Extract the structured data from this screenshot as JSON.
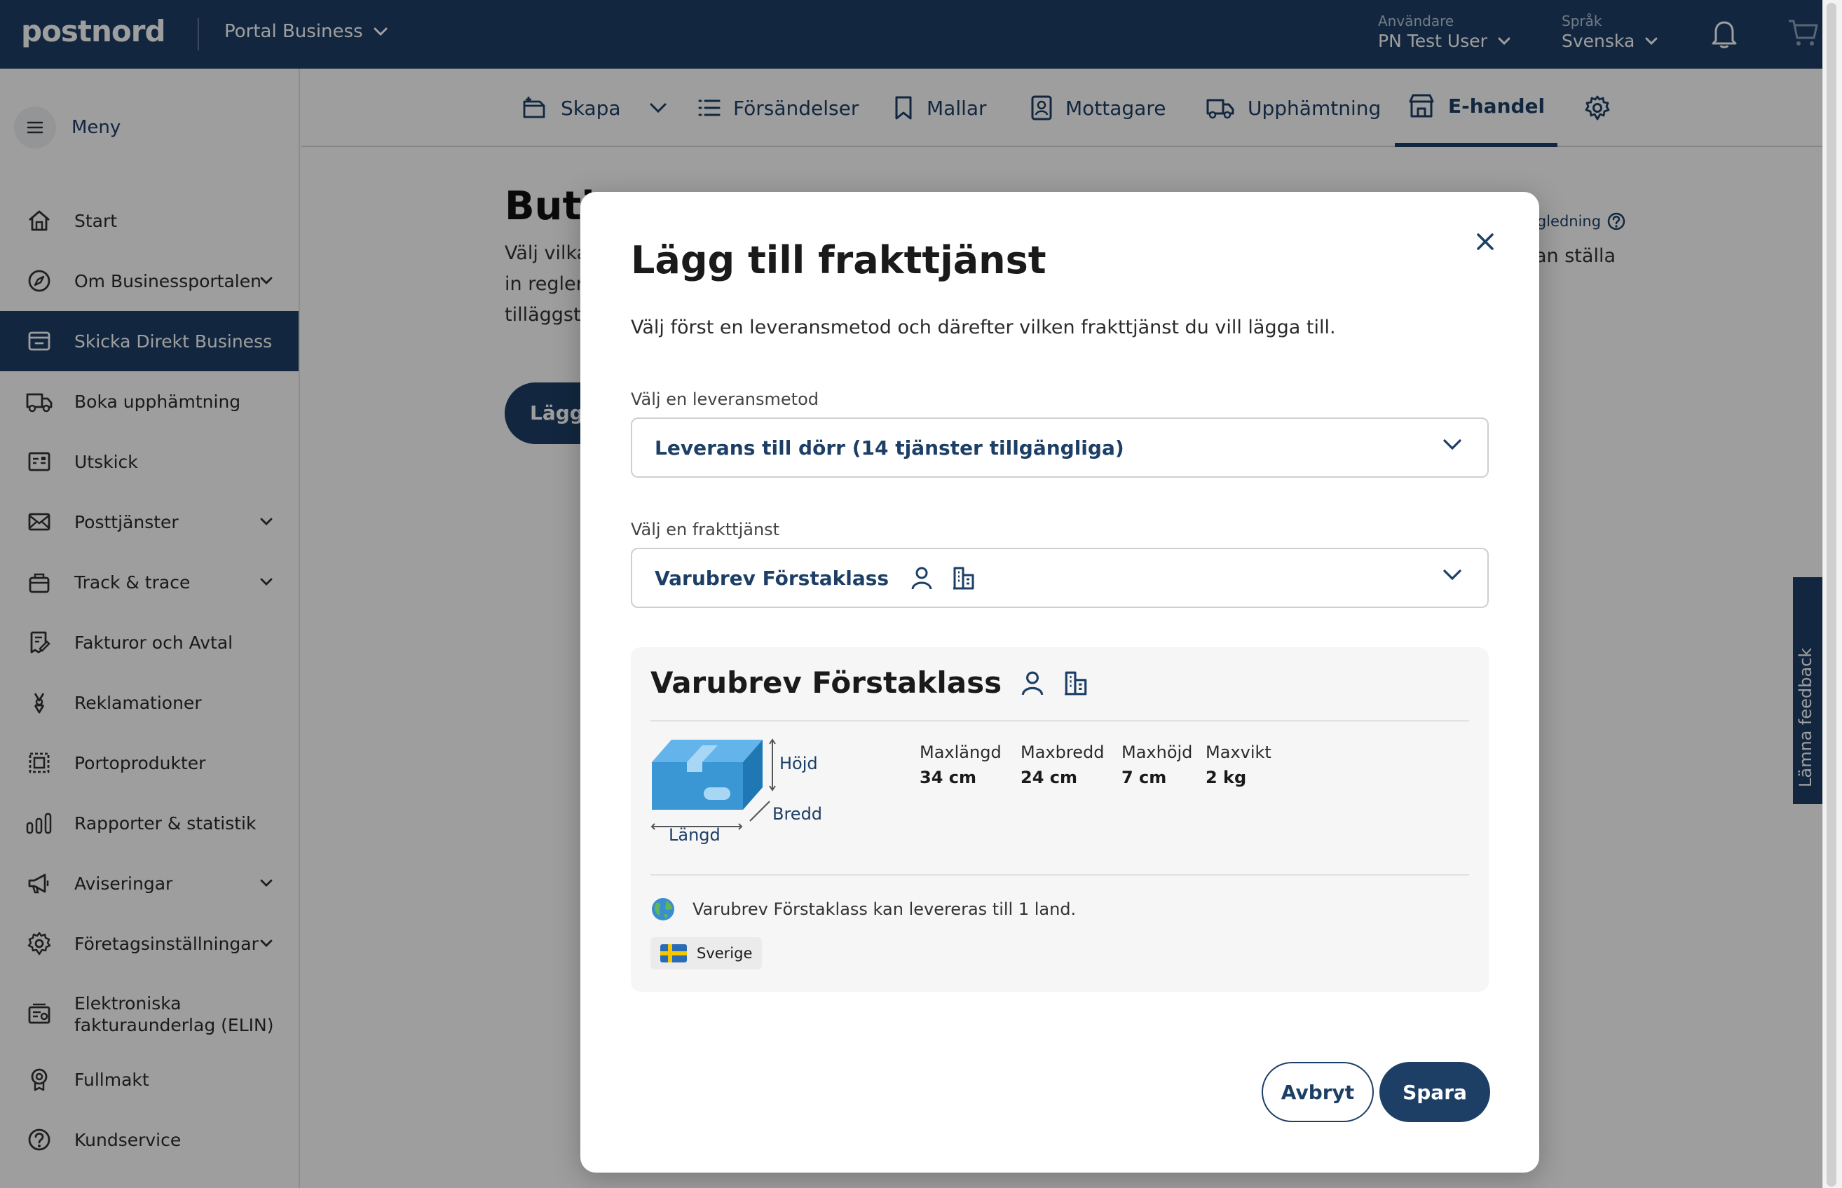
{
  "topbar": {
    "logo": "postnord",
    "portal": "Portal Business",
    "user_label": "Användare",
    "user_value": "PN Test User",
    "lang_label": "Språk",
    "lang_value": "Svenska"
  },
  "sidebar": {
    "menu_label": "Meny",
    "items": [
      {
        "label": "Start",
        "icon": "home-icon"
      },
      {
        "label": "Om Businessportalen",
        "icon": "compass-icon",
        "expandable": true
      },
      {
        "label": "Skicka Direkt Business",
        "icon": "box-icon",
        "active": true
      },
      {
        "label": "Boka upphämtning",
        "icon": "truck-icon"
      },
      {
        "label": "Utskick",
        "icon": "mailing-icon"
      },
      {
        "label": "Posttjänster",
        "icon": "envelope-icon",
        "expandable": true
      },
      {
        "label": "Track & trace",
        "icon": "package-track-icon",
        "expandable": true
      },
      {
        "label": "Fakturor och Avtal",
        "icon": "invoice-icon"
      },
      {
        "label": "Reklamationer",
        "icon": "claim-icon"
      },
      {
        "label": "Portoprodukter",
        "icon": "stamp-icon"
      },
      {
        "label": "Rapporter & statistik",
        "icon": "stats-icon"
      },
      {
        "label": "Aviseringar",
        "icon": "megaphone-icon",
        "expandable": true
      },
      {
        "label": "Företagsinställningar",
        "icon": "gear-icon",
        "expandable": true
      },
      {
        "label": "Elektroniska fakturaunderlag (ELIN)",
        "icon": "elin-icon"
      },
      {
        "label": "Fullmakt",
        "icon": "badge-icon"
      },
      {
        "label": "Kundservice",
        "icon": "help-icon"
      }
    ]
  },
  "tabs": [
    {
      "label": "Skapa",
      "icon": "create-shipment-icon"
    },
    {
      "label": "Försändelser",
      "icon": "list-icon"
    },
    {
      "label": "Mallar",
      "icon": "bookmark-icon"
    },
    {
      "label": "Mottagare",
      "icon": "contact-icon"
    },
    {
      "label": "Upphämtning",
      "icon": "truck-icon"
    },
    {
      "label": "E-handel",
      "icon": "store-icon",
      "active": true
    }
  ],
  "background": {
    "title": "Buti",
    "line1": "Välj vilka",
    "line2": "in regler",
    "line3": "tilläggstj",
    "button": "Lägg",
    "guide_link": "ägledning",
    "right_text": "an ställa"
  },
  "feedback": "Lämna feedback",
  "modal": {
    "title": "Lägg till frakttjänst",
    "description": "Välj först en leveransmetod och därefter vilken frakttjänst du vill lägga till.",
    "delivery_label": "Välj en leveransmetod",
    "delivery_value": "Leverans till dörr (14 tjänster tillgängliga)",
    "service_label": "Välj en frakttjänst",
    "service_value": "Varubrev Förstaklass",
    "card": {
      "title": "Varubrev Förstaklass",
      "dim_height": "Höjd",
      "dim_width": "Bredd",
      "dim_length": "Längd",
      "specs": [
        {
          "label": "Maxlängd",
          "value": "34 cm"
        },
        {
          "label": "Maxbredd",
          "value": "24 cm"
        },
        {
          "label": "Maxhöjd",
          "value": "7 cm"
        },
        {
          "label": "Maxvikt",
          "value": "2 kg"
        }
      ],
      "countries_text": "Varubrev Förstaklass kan levereras till 1 land.",
      "country": "Sverige"
    },
    "cancel": "Avbryt",
    "save": "Spara"
  },
  "colors": {
    "brand_navy": "#1d3f66",
    "box_blue": "#3a97d4",
    "flag_blue": "#2a6bb5",
    "flag_yellow": "#f7c600"
  }
}
